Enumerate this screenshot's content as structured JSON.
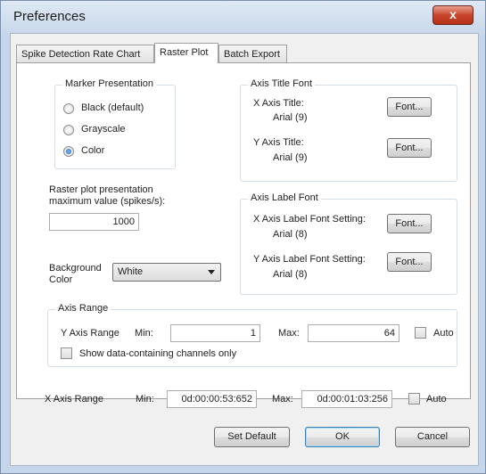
{
  "window": {
    "title": "Preferences",
    "close_glyph": "x"
  },
  "tabs": [
    "Spike Detection Rate Chart",
    "Raster Plot",
    "Batch Export"
  ],
  "active_tab": "Raster Plot",
  "marker": {
    "title": "Marker Presentation",
    "options": [
      "Black (default)",
      "Grayscale",
      "Color"
    ],
    "selected": "Color"
  },
  "max_value": {
    "label_line1": "Raster plot presentation",
    "label_line2": "maximum value (spikes/s):",
    "value": "1000"
  },
  "background": {
    "label_line1": "Background",
    "label_line2": "Color",
    "value": "White"
  },
  "axis_title_font": {
    "title": "Axis Title Font",
    "x_label": "X Axis Title:",
    "x_font": "Arial (9)",
    "y_label": "Y Axis Title:",
    "y_font": "Arial (9)",
    "button": "Font..."
  },
  "axis_label_font": {
    "title": "Axis Label Font",
    "x_label": "X Axis Label Font Setting:",
    "x_font": "Arial (8)",
    "y_label": "Y Axis Label Font Setting:",
    "y_font": "Arial (8)",
    "button": "Font..."
  },
  "axis_range": {
    "title": "Axis Range",
    "y_label": "Y Axis Range",
    "min_label": "Min:",
    "min_value": "1",
    "max_label": "Max:",
    "max_value": "64",
    "auto_label": "Auto",
    "auto_checked": false,
    "show_only_label": "Show data-containing channels only",
    "show_only_checked": false
  },
  "x_range": {
    "label": "X Axis Range",
    "min_label": "Min:",
    "min_value": "0d:00:00:53:652",
    "max_label": "Max:",
    "max_value": "0d:00:01:03:256",
    "auto_label": "Auto",
    "auto_checked": false
  },
  "buttons": {
    "set_default": "Set Default",
    "ok": "OK",
    "cancel": "Cancel"
  }
}
